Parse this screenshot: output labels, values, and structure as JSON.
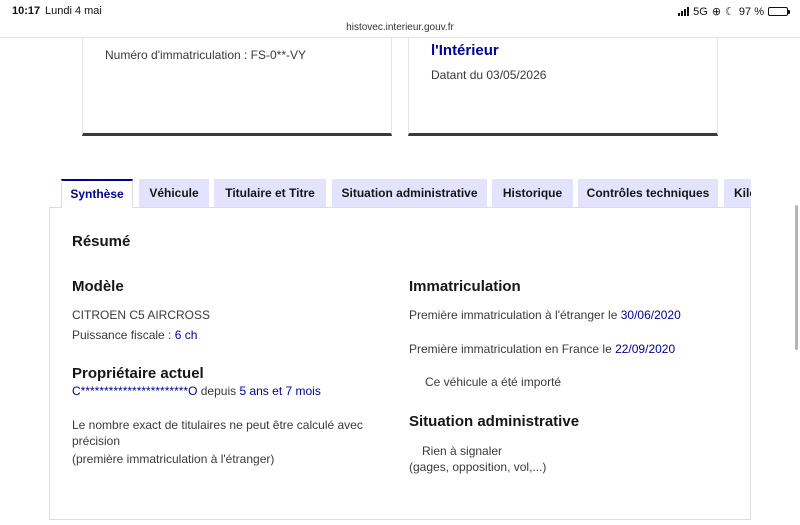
{
  "status_bar": {
    "time": "10:17",
    "date": "Lundi 4 mai",
    "network": "5G",
    "battery": "97 %",
    "battery_level": 0.97
  },
  "url": "histovec.interieur.gouv.fr",
  "cards": {
    "left": {
      "plate_text": "Numéro d'immatriculation : FS-0**-VY"
    },
    "right": {
      "heading": "l'Intérieur",
      "since": "Datant du 03/05/2026"
    }
  },
  "tabs": [
    {
      "label": "Synthèse",
      "active": true
    },
    {
      "label": "Véhicule",
      "active": false
    },
    {
      "label": "Titulaire et Titre",
      "active": false
    },
    {
      "label": "Situation administrative",
      "active": false
    },
    {
      "label": "Historique",
      "active": false
    },
    {
      "label": "Contrôles techniques",
      "active": false
    },
    {
      "label": "Kilo",
      "active": false
    }
  ],
  "summary": {
    "title": "Résumé",
    "model": {
      "title": "Modèle",
      "name": "CITROEN C5 AIRCROSS",
      "power_label": "Puissance fiscale : ",
      "power_value": "6 ch"
    },
    "owner": {
      "title": "Propriétaire actuel",
      "name": "C***********************O",
      "since_label": " depuis ",
      "since_value": "5 ans et 7 mois",
      "note_line1": "Le nombre exact de titulaires ne peut être calculé avec",
      "note_line2": "précision",
      "note_line3": "(première immatriculation à l'étranger)"
    },
    "registration": {
      "title": "Immatriculation",
      "foreign_label": "Première immatriculation à l'étranger le ",
      "foreign_date": "30/06/2020",
      "france_label": "Première immatriculation en France le ",
      "france_date": "22/09/2020",
      "imported": "Ce véhicule a été importé"
    },
    "admin": {
      "title": "Situation administrative",
      "status": "Rien à signaler",
      "detail": "(gages, opposition, vol,...)"
    }
  }
}
